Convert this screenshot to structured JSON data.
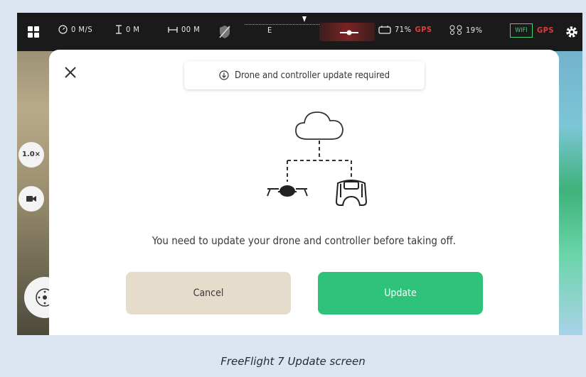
{
  "statusbar": {
    "speed": "0 M/S",
    "altitude": "0 M",
    "distance": "00 M",
    "compass_heading": "E",
    "controller_battery": "71%",
    "gps_left": "GPS",
    "drone_battery": "19%",
    "wifi": "WIFI",
    "gps_right": "GPS"
  },
  "controls": {
    "zoom": "1.0×"
  },
  "modal": {
    "banner": "Drone and controller update required",
    "message": "You need to update your drone and controller before taking off.",
    "cancel_label": "Cancel",
    "update_label": "Update"
  },
  "caption": "FreeFlight 7 Update screen",
  "colors": {
    "update_button": "#2fc27a",
    "cancel_button": "#e5dccb",
    "gps_warning": "#e23b3b",
    "wifi_ok": "#42d27a"
  }
}
